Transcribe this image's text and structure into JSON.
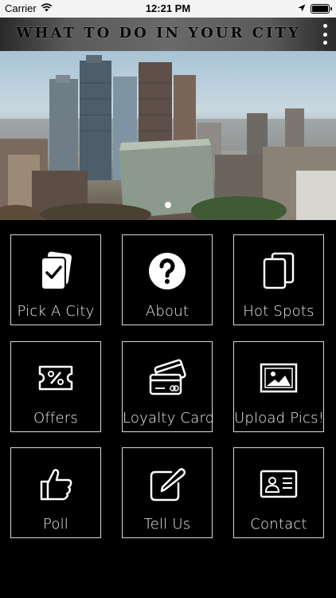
{
  "status_bar": {
    "carrier": "Carrier",
    "time": "12:21 PM"
  },
  "header": {
    "title": "WHAT TO DO IN YOUR CITY"
  },
  "tiles": [
    {
      "label": "Pick A City",
      "icon": "checklist-document-icon"
    },
    {
      "label": "About",
      "icon": "question-circle-icon"
    },
    {
      "label": "Hot Spots",
      "icon": "cards-icon"
    },
    {
      "label": "Offers",
      "icon": "percent-ticket-icon"
    },
    {
      "label": "Loyalty Card",
      "icon": "credit-cards-icon"
    },
    {
      "label": "Upload Pics!",
      "icon": "picture-frame-icon"
    },
    {
      "label": "Poll",
      "icon": "thumbs-up-icon"
    },
    {
      "label": "Tell Us",
      "icon": "pencil-edit-icon"
    },
    {
      "label": "Contact",
      "icon": "contact-card-icon"
    }
  ]
}
